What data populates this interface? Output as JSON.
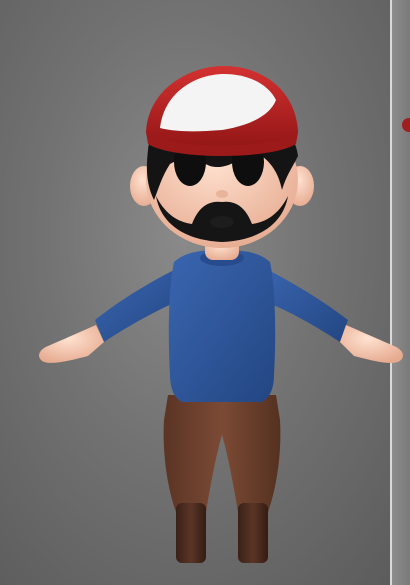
{
  "scene": {
    "subject_icon": "cartoon-character-icon",
    "colors": {
      "background": "#727272",
      "cap_front": "#f2f2f2",
      "cap_red": "#b81f1f",
      "skin": "#f1c7ae",
      "hair": "#151515",
      "shirt": "#2f5597",
      "pants": "#6a3f2c",
      "boots": "#4a2b1f"
    }
  }
}
